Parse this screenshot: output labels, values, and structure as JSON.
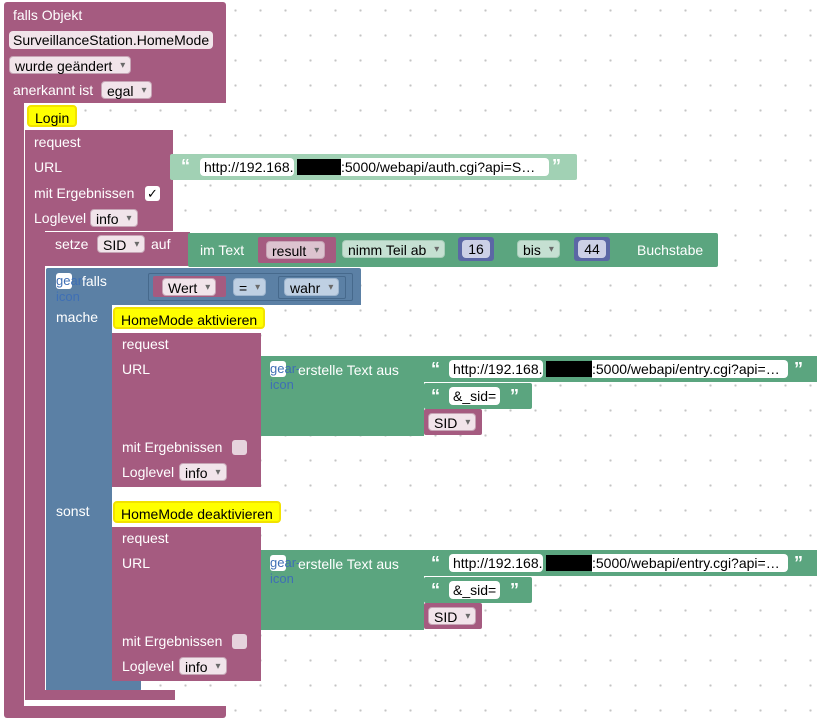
{
  "trigger": {
    "falls_objekt": "falls Objekt",
    "object_id": "SurveillanceStation.HomeMode",
    "change": "wurde geändert",
    "ack_label": "anerkannt ist",
    "ack_value": "egal"
  },
  "login": {
    "comment": "Login",
    "request": "request",
    "url_label": "URL",
    "url_prefix": "http://192.168.",
    "url_suffix": ":5000/webapi/auth.cgi?api=S…",
    "with_results": "mit Ergebnissen",
    "with_results_checked": true,
    "loglevel_label": "Loglevel",
    "loglevel_value": "info"
  },
  "set_sid": {
    "setze": "setze",
    "var": "SID",
    "auf": "auf",
    "im_text": "im Text",
    "result": "result",
    "nimm": "nimm Teil ab",
    "from": "16",
    "bis": "bis",
    "to": "44",
    "buchstabe": "Buchstabe"
  },
  "if_block": {
    "falls": "falls",
    "left": "Wert",
    "op": "=",
    "right": "wahr",
    "mache": "mache",
    "sonst": "sonst"
  },
  "activate": {
    "comment": "HomeMode aktivieren",
    "request": "request",
    "url_label": "URL",
    "create_text": "erstelle Text aus",
    "url_prefix": "http://192.168.",
    "url_suffix": ":5000/webapi/entry.cgi?api=…",
    "sid_param": "&_sid=",
    "sid_var": "SID",
    "with_results": "mit Ergebnissen",
    "with_results_checked": false,
    "loglevel_label": "Loglevel",
    "loglevel_value": "info"
  },
  "deactivate": {
    "comment": "HomeMode deaktivieren",
    "request": "request",
    "url_label": "URL",
    "create_text": "erstelle Text aus",
    "url_prefix": "http://192.168.",
    "url_suffix": ":5000/webapi/entry.cgi?api=…",
    "sid_param": "&_sid=",
    "sid_var": "SID",
    "with_results": "mit Ergebnissen",
    "with_results_checked": false,
    "loglevel_label": "Loglevel",
    "loglevel_value": "info"
  },
  "icons": {
    "gear": "gear-icon",
    "quote_open": "“",
    "quote_close": "”",
    "check": "✓"
  },
  "colors": {
    "event_block": "#a55b80",
    "text_block": "#5ba57f",
    "logic_block": "#5b80a5",
    "math_block": "#5b67a5",
    "comment": "#ffff00"
  }
}
